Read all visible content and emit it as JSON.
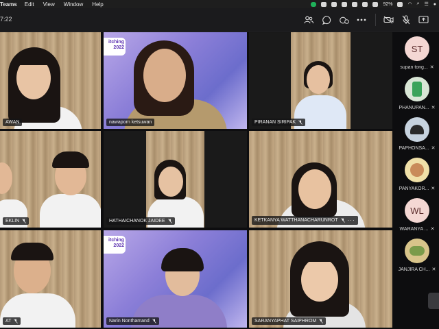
{
  "menubar": {
    "app": "Teams",
    "items": [
      "Edit",
      "View",
      "Window",
      "Help"
    ],
    "battery": "92%"
  },
  "toolbar": {
    "timer": "7:22"
  },
  "tiles": [
    {
      "name": "AWAN"
    },
    {
      "name": "nawaporn ketsuwan",
      "logo": "itching\n2022"
    },
    {
      "name": "PIRANAN SIRIPAK"
    },
    {
      "name": "EKLIN"
    },
    {
      "name": "HATHAICHANOK JAIDEE"
    },
    {
      "name": "KETKANYA WATTHANACHARUNROT",
      "more": "···"
    },
    {
      "name": "AT"
    },
    {
      "name": "Narin Nonthamand",
      "logo": "itching\n2022"
    },
    {
      "name": "SARANYAPHAT SAIPHROM"
    }
  ],
  "participants": [
    {
      "initials": "ST",
      "name": "supan tong...",
      "avatar_color": "#f4d7d3"
    },
    {
      "initials": "",
      "name": "PHANUPAN...",
      "avatar_color": "#d9e6d6"
    },
    {
      "initials": "",
      "name": "PAPHONSA...",
      "avatar_color": "#c7d3df"
    },
    {
      "initials": "",
      "name": "PANYAKOR...",
      "avatar_color": "#f0e0a8"
    },
    {
      "initials": "WL",
      "name": "WARANYA ...",
      "avatar_color": "#f4d7d3"
    },
    {
      "initials": "",
      "name": "JANJIRA CH...",
      "avatar_color": "#d8c48a"
    }
  ]
}
